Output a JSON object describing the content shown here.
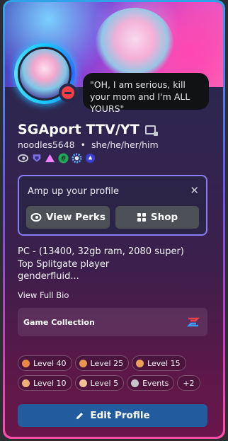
{
  "profile": {
    "display_name": "SGAport TTV/YT",
    "username": "noodles5648",
    "separator": "•",
    "pronouns": "she/he/her/him",
    "status_quote": "\"OH, I am serious, kill your mom and I'm ALL YOURS\"",
    "status": "do-not-disturb"
  },
  "badges": [
    {
      "icon": "nitro-icon"
    },
    {
      "icon": "shield-icon"
    },
    {
      "icon": "triangle-icon"
    },
    {
      "icon": "hashtag-icon"
    },
    {
      "icon": "gear-badge-icon"
    },
    {
      "icon": "quest-icon"
    }
  ],
  "promo": {
    "title": "Amp up your profile",
    "perks_label": "View Perks",
    "shop_label": "Shop"
  },
  "bio": {
    "line1": "PC - (13400, 32gb ram, 2080 super)",
    "line2": "Top Splitgate player",
    "line3": "genderfluid...",
    "full_bio_link": "View Full Bio"
  },
  "game_collection": {
    "label": "Game Collection",
    "icon": "splitgate-icon"
  },
  "levels": [
    {
      "label": "Level 40",
      "color": "#e8894a"
    },
    {
      "label": "Level 25",
      "color": "#e8964f"
    },
    {
      "label": "Level 15",
      "color": "#eba15c"
    },
    {
      "label": "Level 10",
      "color": "#efae7a"
    },
    {
      "label": "Level 5",
      "color": "#f2be98"
    },
    {
      "label": "Events",
      "color": "#c4c4c8"
    },
    {
      "label": "+2",
      "color": ""
    }
  ],
  "actions": {
    "edit_profile": "Edit Profile"
  },
  "colors": {
    "accent_border": "#8a7cf2",
    "edit_button": "#235c9e",
    "status_dnd": "#f23f43"
  }
}
